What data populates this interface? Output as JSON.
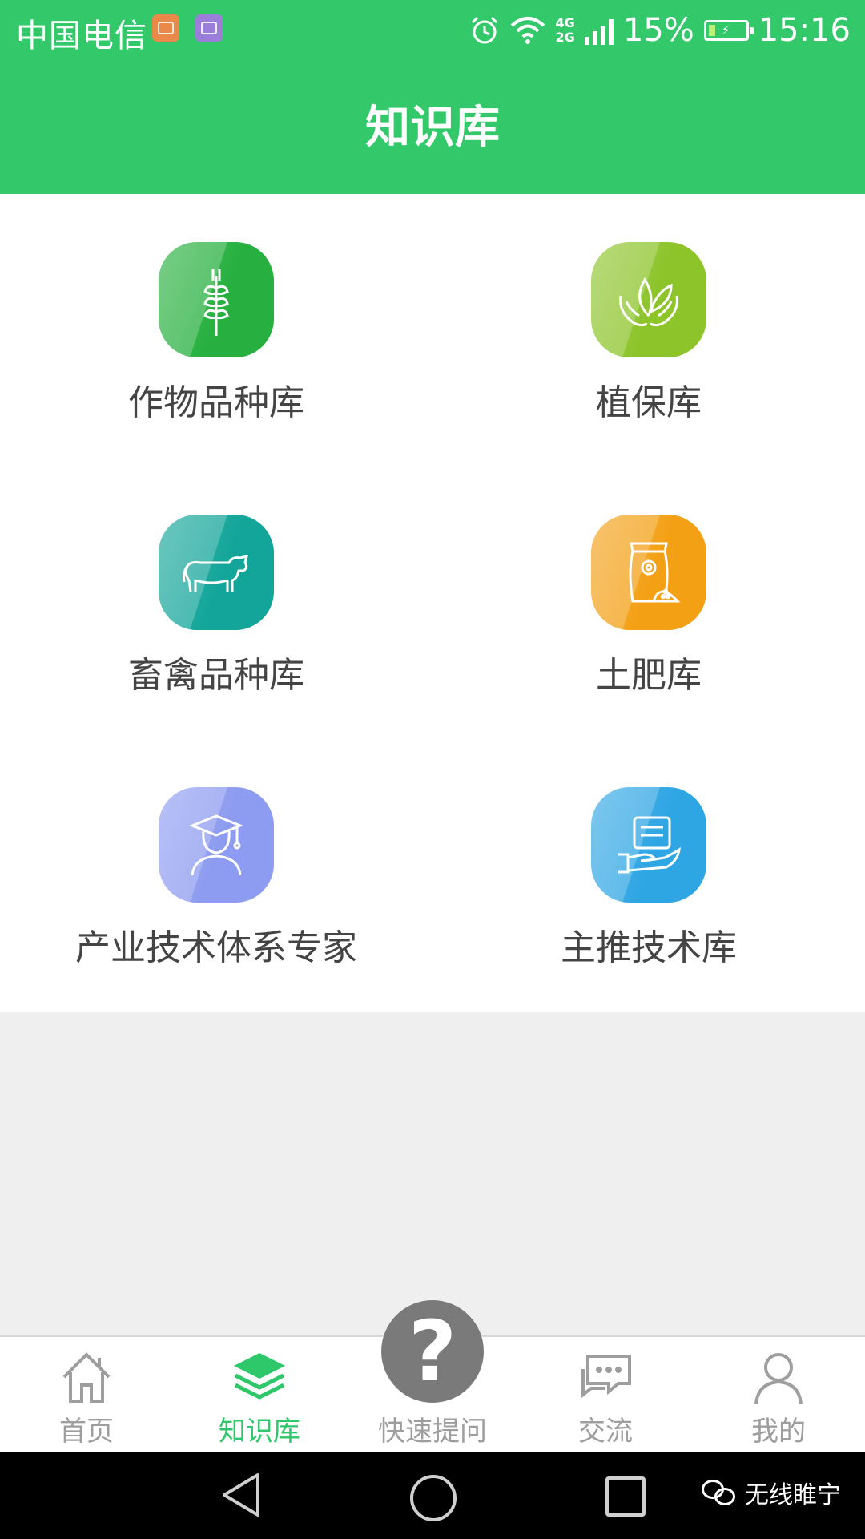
{
  "status_bar": {
    "carrier": "中国电信",
    "network_top": "4G",
    "network_bottom": "2G",
    "battery": "15%",
    "time": "15:16",
    "icons": [
      "health-app-icon",
      "gallery-app-icon",
      "alarm-icon",
      "wifi-icon",
      "signal-icon",
      "battery-charging-icon"
    ]
  },
  "header": {
    "title": "知识库"
  },
  "grid": {
    "items": [
      {
        "label": "作物品种库",
        "icon": "wheat-icon",
        "color": "#27b03f"
      },
      {
        "label": "植保库",
        "icon": "plant-in-hands-icon",
        "color": "#8cc42a"
      },
      {
        "label": "畜禽品种库",
        "icon": "cow-icon",
        "color": "#13a59a"
      },
      {
        "label": "土肥库",
        "icon": "fertilizer-bag-icon",
        "color": "#f3a015"
      },
      {
        "label": "产业技术体系专家",
        "icon": "graduate-expert-icon",
        "color": "#8d9bf0"
      },
      {
        "label": "主推技术库",
        "icon": "tech-card-hand-icon",
        "color": "#2fa6e4"
      }
    ]
  },
  "bottom_nav": {
    "items": [
      {
        "label": "首页",
        "icon": "home-icon",
        "active": false
      },
      {
        "label": "知识库",
        "icon": "layers-icon",
        "active": true
      },
      {
        "label": "快速提问",
        "icon": "question-icon",
        "active": false
      },
      {
        "label": "交流",
        "icon": "chat-icon",
        "active": false
      },
      {
        "label": "我的",
        "icon": "person-icon",
        "active": false
      }
    ],
    "fab_symbol": "?"
  },
  "colors": {
    "primary": "#33c86a",
    "active_nav": "#2ec86a",
    "inactive_nav": "#9e9e9e"
  },
  "watermark": {
    "text": "无线睢宁"
  }
}
